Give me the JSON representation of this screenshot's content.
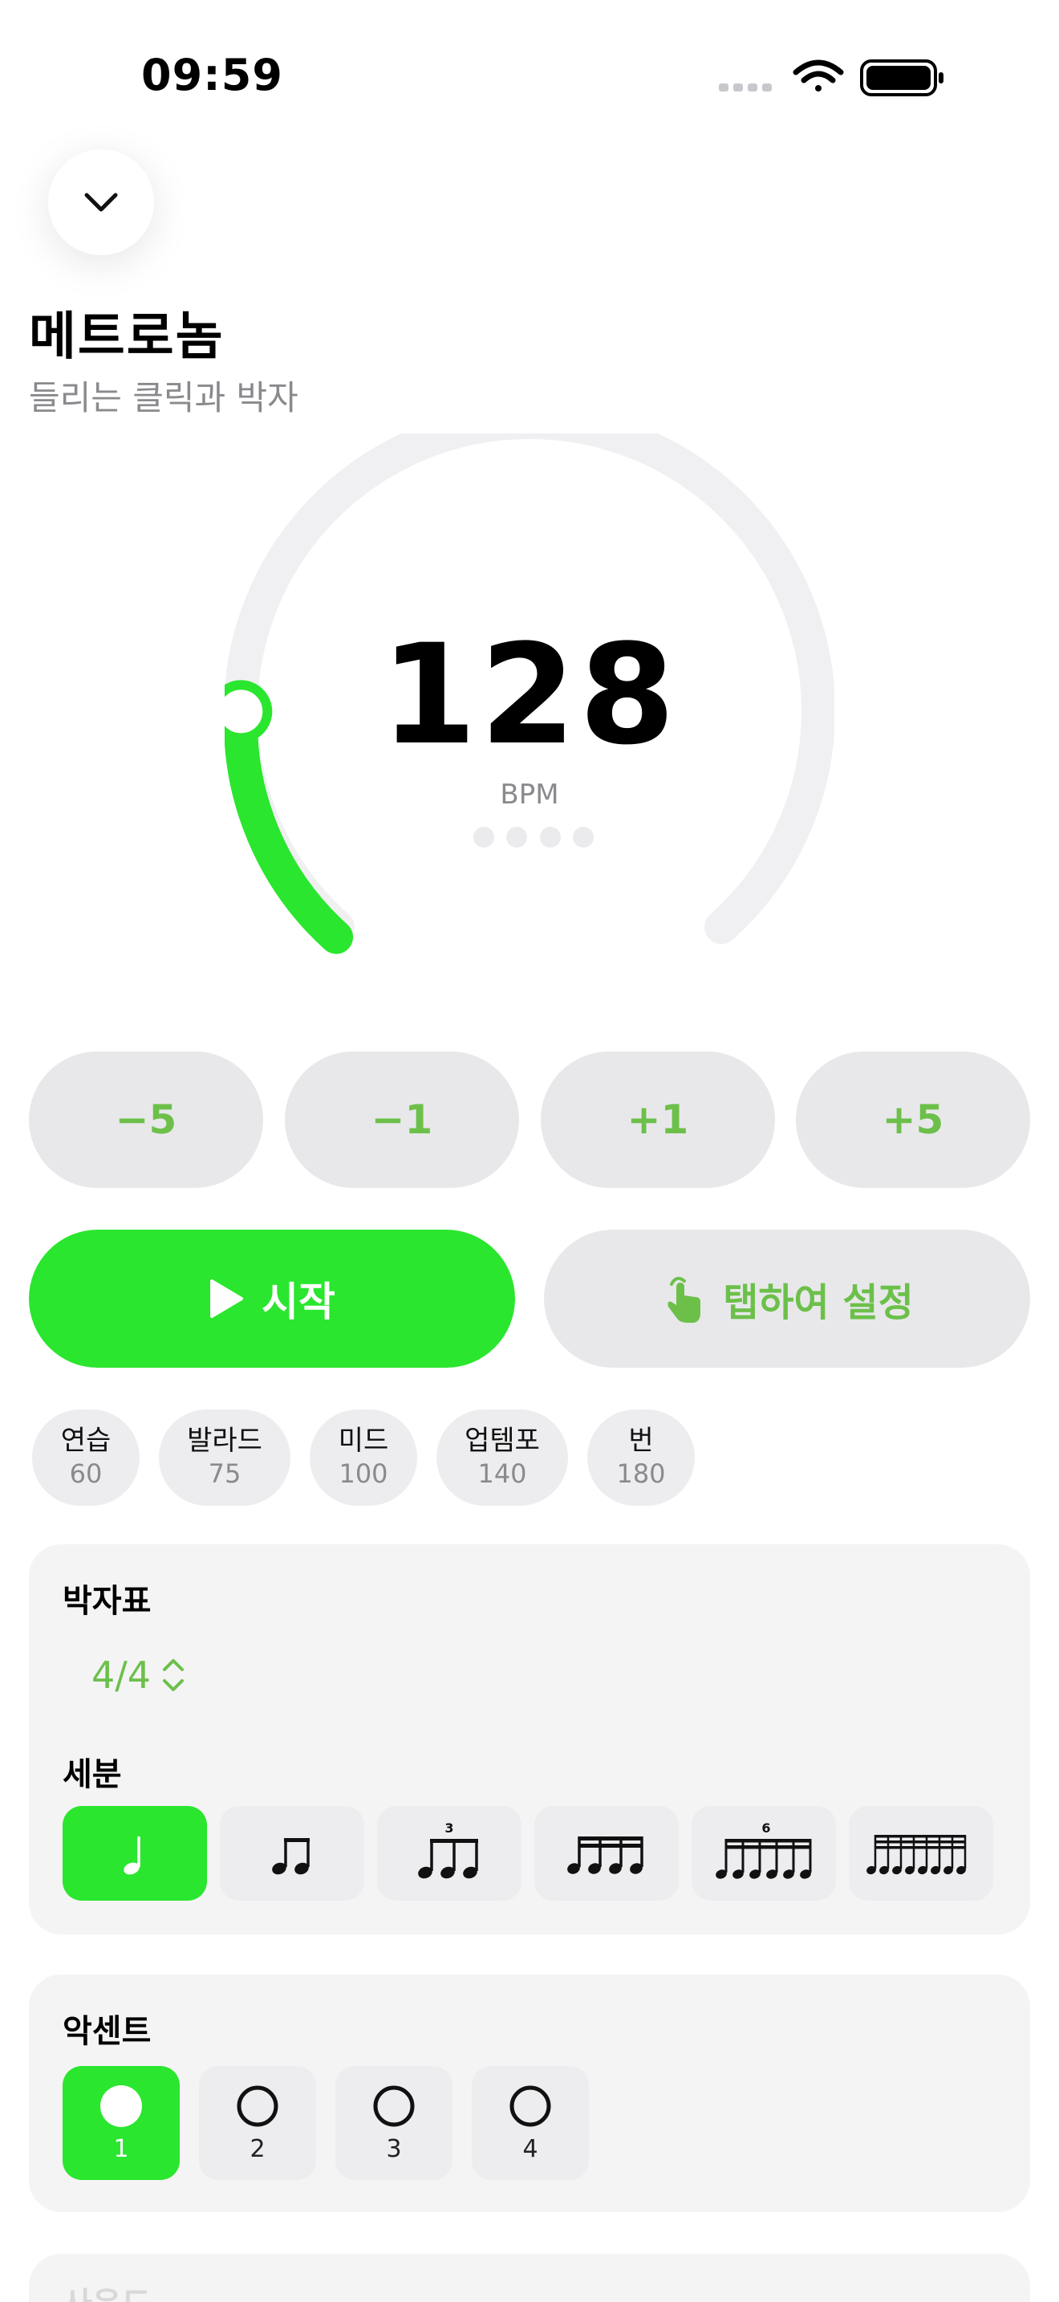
{
  "status_bar": {
    "time": "09:59"
  },
  "header": {
    "title": "메트로놈",
    "subtitle": "들리는 클릭과 박자"
  },
  "dial": {
    "bpm": "128",
    "unit": "BPM",
    "level_fraction": 0.19
  },
  "step_buttons": [
    {
      "label": "−5"
    },
    {
      "label": "−1"
    },
    {
      "label": "+1"
    },
    {
      "label": "+5"
    }
  ],
  "actions": {
    "start_label": "시작",
    "tap_label": "탭하여 설정"
  },
  "presets": [
    {
      "name": "연습",
      "bpm": "60"
    },
    {
      "name": "발라드",
      "bpm": "75"
    },
    {
      "name": "미드",
      "bpm": "100"
    },
    {
      "name": "업템포",
      "bpm": "140"
    },
    {
      "name": "번",
      "bpm": "180"
    }
  ],
  "time_signature": {
    "label": "박자표",
    "value": "4/4"
  },
  "subdivision": {
    "label": "세분",
    "options": [
      "quarter-note-icon",
      "eighth-notes-icon",
      "triplet-icon",
      "sixteenth-notes-icon",
      "sextuplet-icon",
      "thirty-second-notes-icon"
    ],
    "triplet_mark": "3",
    "sextuplet_mark": "6",
    "selected_index": 0
  },
  "accent": {
    "label": "악센트",
    "beats": [
      "1",
      "2",
      "3",
      "4"
    ],
    "selected_index": 0
  },
  "volume": {
    "label": "사운드"
  },
  "colors": {
    "accent_green": "#2ae62e",
    "text_green": "#6cc04a",
    "track_gray": "#f0f0f2"
  }
}
